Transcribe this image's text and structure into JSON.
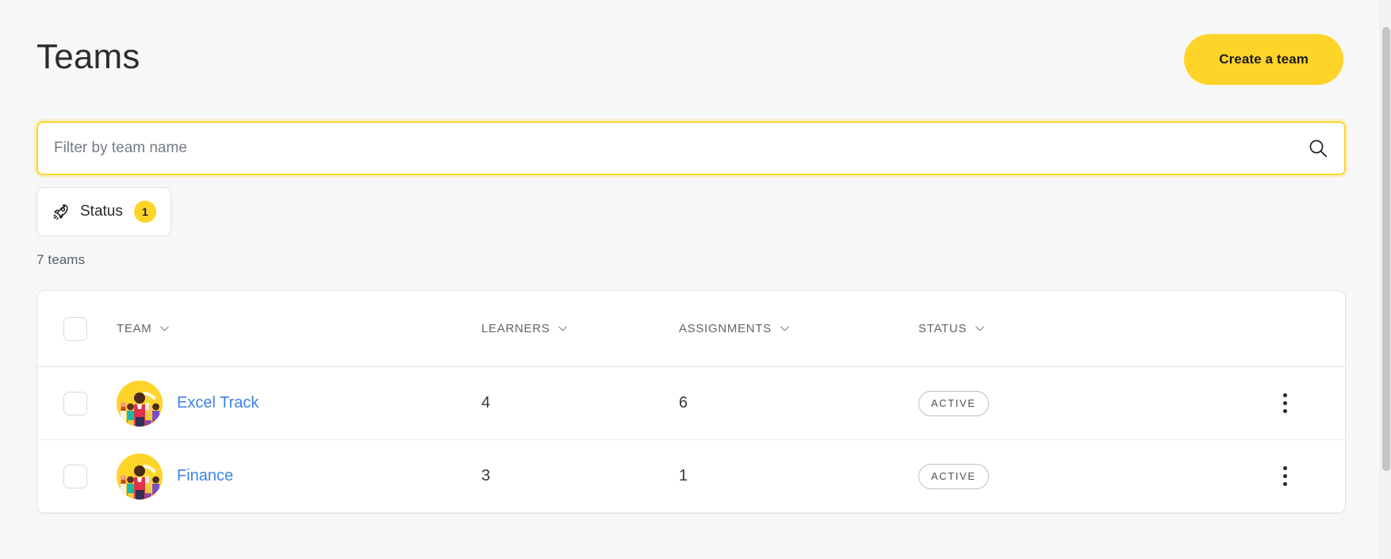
{
  "header": {
    "title": "Teams",
    "create_button_label": "Create a team"
  },
  "search": {
    "placeholder": "Filter by team name",
    "value": "",
    "icon": "search-icon"
  },
  "filters": {
    "status_chip": {
      "icon": "rocket-icon",
      "label": "Status",
      "badge": "1"
    }
  },
  "summary": {
    "count_text": "7 teams"
  },
  "table": {
    "columns": [
      {
        "key": "team",
        "label": "TEAM",
        "sort_icon": "chevron-down-icon"
      },
      {
        "key": "learners",
        "label": "LEARNERS",
        "sort_icon": "chevron-down-icon"
      },
      {
        "key": "assignments",
        "label": "ASSIGNMENTS",
        "sort_icon": "chevron-down-icon"
      },
      {
        "key": "status",
        "label": "STATUS",
        "sort_icon": "chevron-down-icon"
      }
    ],
    "rows": [
      {
        "name": "Excel Track",
        "learners": "4",
        "assignments": "6",
        "status": "ACTIVE",
        "avatar": "team-group-illustration-avatar",
        "menu_icon": "kebab-menu-icon"
      },
      {
        "name": "Finance",
        "learners": "3",
        "assignments": "1",
        "status": "ACTIVE",
        "avatar": "team-group-illustration-avatar",
        "menu_icon": "kebab-menu-icon"
      }
    ]
  },
  "colors": {
    "brand_yellow": "#FFD429",
    "link_blue": "#3E82E8",
    "page_bg": "#F7F7F7",
    "card_bg": "#FFFFFF",
    "border": "#DFE3E8",
    "muted_text": "#5D666F"
  }
}
